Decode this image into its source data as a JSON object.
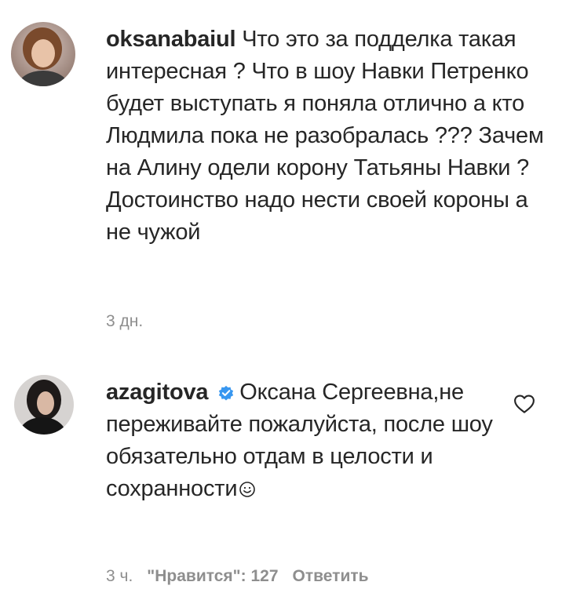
{
  "comments": [
    {
      "username": "oksanabaiul",
      "verified": false,
      "text": "Что это за подделка такая интересная ? Что в шоу Навки Петренко будет выступать я поняла отлично а кто Людмила пока не разобралась ??? Зачем на Алину одели корону Татьяны Навки ? Достоинство надо нести своей короны а не чужой",
      "time": "3 дн.",
      "avatar_icon": "user-avatar-photo"
    },
    {
      "username": "azagitova",
      "verified": true,
      "text": "Оксана Сергеевна,не переживайте пожалуйста, после шоу обязательно отдам в целости и сохранности",
      "emoji": "☺",
      "time": "3 ч.",
      "likes_label": "\"Нравится\": 127",
      "reply_label": "Ответить",
      "avatar_icon": "user-avatar-photo",
      "like_icon": "heart-outline-icon"
    }
  ],
  "colors": {
    "text": "#262626",
    "muted": "#8e8e8e",
    "verified": "#3897f0"
  }
}
